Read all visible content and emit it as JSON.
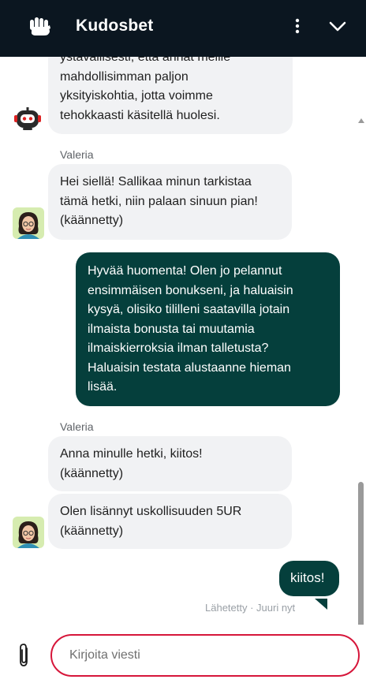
{
  "header": {
    "brand": "Kudosbet",
    "logo_icon": "fist-logo-icon",
    "menu_icon": "more-vertical-icon",
    "collapse_icon": "chevron-down-icon",
    "background": "#0b1620"
  },
  "messages": [
    {
      "type": "incoming",
      "sender": "",
      "avatar": "bot-icon",
      "lines": [
        "ystävällisesti, että annat meille",
        "mahdollisimman paljon",
        "yksityiskohtia, jotta voimme",
        "tehokkaasti käsitellä huolesi."
      ]
    },
    {
      "type": "incoming",
      "sender": "Valeria",
      "avatar": "agent-avatar",
      "lines": [
        "Hei siellä! Sallikaa minun tarkistaa",
        "tämä hetki, niin palaan sinuun pian!",
        "(käännetty)"
      ]
    },
    {
      "type": "outgoing",
      "lines": [
        "Hyvää huomenta! Olen jo pelannut",
        "ensimmäisen bonukseni, ja haluaisin",
        "kysyä, olisiko tililleni saatavilla jotain",
        "ilmaista bonusta tai muutamia",
        "ilmaiskierroksia ilman talletusta?",
        "Haluaisin testata alustaanne hieman",
        "lisää."
      ]
    },
    {
      "type": "incoming",
      "sender": "Valeria",
      "lines": [
        "Anna minulle hetki, kiitos!",
        "(käännetty)"
      ]
    },
    {
      "type": "incoming",
      "sender": "",
      "avatar": "agent-avatar",
      "lines": [
        "Olen lisännyt uskollisuuden 5UR",
        "(käännetty)"
      ]
    },
    {
      "type": "outgoing",
      "lines": [
        "kiitos!"
      ],
      "status": "Lähetetty · Juuri nyt"
    }
  ],
  "composer": {
    "placeholder": "Kirjoita viesti",
    "attach_icon": "paperclip-icon",
    "accent": "#d6163a"
  },
  "colors": {
    "outgoing_bubble": "#053f3c",
    "incoming_bubble": "#f1f2f4"
  }
}
